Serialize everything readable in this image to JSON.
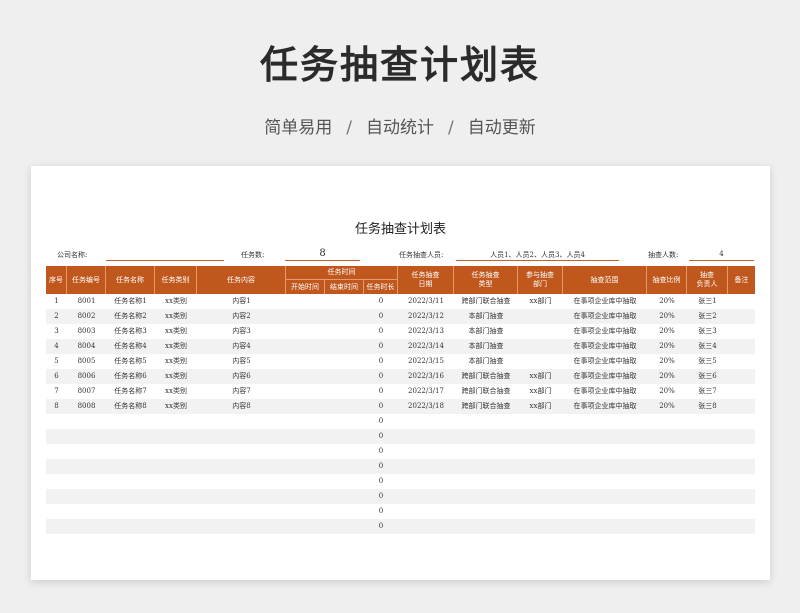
{
  "header": {
    "title": "任务抽查计划表",
    "subtitle_parts": [
      "简单易用",
      "自动统计",
      "自动更新"
    ],
    "separator": "/"
  },
  "sheet": {
    "title": "任务抽查计划表",
    "company_label": "公司名称:",
    "company_value": "",
    "task_count_label": "任务数:",
    "task_count_value": "8",
    "staff_label": "任务抽查人员:",
    "staff_value": "人员1、人员2、人员3、人员4",
    "staff_count_label": "抽查人数:",
    "staff_count_value": "4"
  },
  "table": {
    "headers": {
      "seq": "序号",
      "code": "任务编号",
      "name": "任务名称",
      "category": "任务类别",
      "content": "任务内容",
      "time_group": "任务时间",
      "start": "开始时间",
      "end": "结束时间",
      "duration": "任务时长",
      "date_l1": "任务抽查",
      "date_l2": "日期",
      "type_l1": "任务抽查",
      "type_l2": "类型",
      "dept_l1": "参与抽查",
      "dept_l2": "部门",
      "scope": "抽查范围",
      "ratio": "抽查比例",
      "owner_l1": "抽查",
      "owner_l2": "负责人",
      "note": "备注"
    },
    "rows": [
      {
        "seq": "1",
        "code": "8001",
        "name": "任务名称1",
        "category": "xx类别",
        "content": "内容1",
        "start": "",
        "end": "",
        "duration": "0",
        "date": "2022/3/11",
        "type": "跨部门联合抽查",
        "dept": "xx部门",
        "scope": "在事项企业库中抽取",
        "ratio": "20%",
        "owner": "张三1",
        "note": ""
      },
      {
        "seq": "2",
        "code": "8002",
        "name": "任务名称2",
        "category": "xx类别",
        "content": "内容2",
        "start": "",
        "end": "",
        "duration": "0",
        "date": "2022/3/12",
        "type": "本部门抽查",
        "dept": "",
        "scope": "在事项企业库中抽取",
        "ratio": "20%",
        "owner": "张三2",
        "note": ""
      },
      {
        "seq": "3",
        "code": "8003",
        "name": "任务名称3",
        "category": "xx类别",
        "content": "内容3",
        "start": "",
        "end": "",
        "duration": "0",
        "date": "2022/3/13",
        "type": "本部门抽查",
        "dept": "",
        "scope": "在事项企业库中抽取",
        "ratio": "20%",
        "owner": "张三3",
        "note": ""
      },
      {
        "seq": "4",
        "code": "8004",
        "name": "任务名称4",
        "category": "xx类别",
        "content": "内容4",
        "start": "",
        "end": "",
        "duration": "0",
        "date": "2022/3/14",
        "type": "本部门抽查",
        "dept": "",
        "scope": "在事项企业库中抽取",
        "ratio": "20%",
        "owner": "张三4",
        "note": ""
      },
      {
        "seq": "5",
        "code": "8005",
        "name": "任务名称5",
        "category": "xx类别",
        "content": "内容5",
        "start": "",
        "end": "",
        "duration": "0",
        "date": "2022/3/15",
        "type": "本部门抽查",
        "dept": "",
        "scope": "在事项企业库中抽取",
        "ratio": "20%",
        "owner": "张三5",
        "note": ""
      },
      {
        "seq": "6",
        "code": "8006",
        "name": "任务名称6",
        "category": "xx类别",
        "content": "内容6",
        "start": "",
        "end": "",
        "duration": "0",
        "date": "2022/3/16",
        "type": "跨部门联合抽查",
        "dept": "xx部门",
        "scope": "在事项企业库中抽取",
        "ratio": "20%",
        "owner": "张三6",
        "note": ""
      },
      {
        "seq": "7",
        "code": "8007",
        "name": "任务名称7",
        "category": "xx类别",
        "content": "内容7",
        "start": "",
        "end": "",
        "duration": "0",
        "date": "2022/3/17",
        "type": "跨部门联合抽查",
        "dept": "xx部门",
        "scope": "在事项企业库中抽取",
        "ratio": "20%",
        "owner": "张三7",
        "note": ""
      },
      {
        "seq": "8",
        "code": "8008",
        "name": "任务名称8",
        "category": "xx类别",
        "content": "内容8",
        "start": "",
        "end": "",
        "duration": "0",
        "date": "2022/3/18",
        "type": "跨部门联合抽查",
        "dept": "xx部门",
        "scope": "在事项企业库中抽取",
        "ratio": "20%",
        "owner": "张三8",
        "note": ""
      },
      {
        "seq": "",
        "code": "",
        "name": "",
        "category": "",
        "content": "",
        "start": "",
        "end": "",
        "duration": "0",
        "date": "",
        "type": "",
        "dept": "",
        "scope": "",
        "ratio": "",
        "owner": "",
        "note": ""
      },
      {
        "seq": "",
        "code": "",
        "name": "",
        "category": "",
        "content": "",
        "start": "",
        "end": "",
        "duration": "0",
        "date": "",
        "type": "",
        "dept": "",
        "scope": "",
        "ratio": "",
        "owner": "",
        "note": ""
      },
      {
        "seq": "",
        "code": "",
        "name": "",
        "category": "",
        "content": "",
        "start": "",
        "end": "",
        "duration": "0",
        "date": "",
        "type": "",
        "dept": "",
        "scope": "",
        "ratio": "",
        "owner": "",
        "note": ""
      },
      {
        "seq": "",
        "code": "",
        "name": "",
        "category": "",
        "content": "",
        "start": "",
        "end": "",
        "duration": "0",
        "date": "",
        "type": "",
        "dept": "",
        "scope": "",
        "ratio": "",
        "owner": "",
        "note": ""
      },
      {
        "seq": "",
        "code": "",
        "name": "",
        "category": "",
        "content": "",
        "start": "",
        "end": "",
        "duration": "0",
        "date": "",
        "type": "",
        "dept": "",
        "scope": "",
        "ratio": "",
        "owner": "",
        "note": ""
      },
      {
        "seq": "",
        "code": "",
        "name": "",
        "category": "",
        "content": "",
        "start": "",
        "end": "",
        "duration": "0",
        "date": "",
        "type": "",
        "dept": "",
        "scope": "",
        "ratio": "",
        "owner": "",
        "note": ""
      },
      {
        "seq": "",
        "code": "",
        "name": "",
        "category": "",
        "content": "",
        "start": "",
        "end": "",
        "duration": "0",
        "date": "",
        "type": "",
        "dept": "",
        "scope": "",
        "ratio": "",
        "owner": "",
        "note": ""
      },
      {
        "seq": "",
        "code": "",
        "name": "",
        "category": "",
        "content": "",
        "start": "",
        "end": "",
        "duration": "0",
        "date": "",
        "type": "",
        "dept": "",
        "scope": "",
        "ratio": "",
        "owner": "",
        "note": ""
      }
    ]
  },
  "colors": {
    "header_bg": "#c0581e",
    "accent_line": "#c0622a",
    "row_alt": "#f2f2f2",
    "page_bg": "#efefef"
  }
}
